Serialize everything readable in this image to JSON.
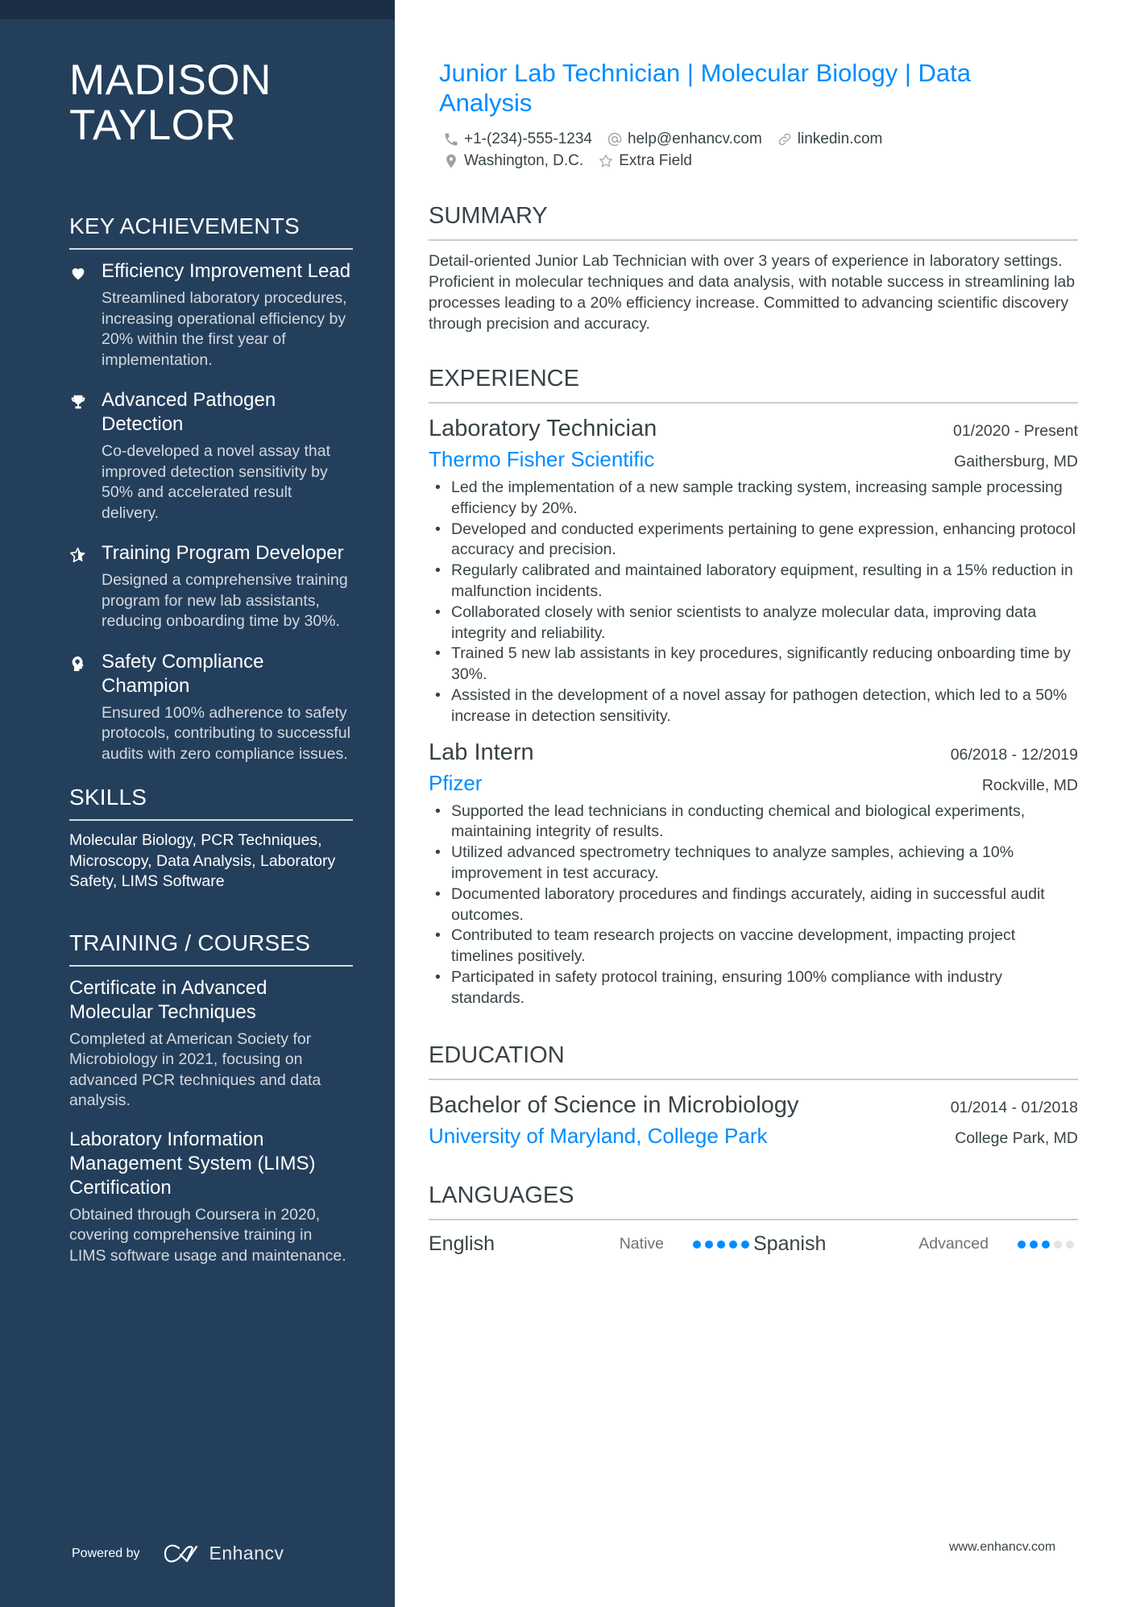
{
  "colors": {
    "sidebar": "#243f5c",
    "sidebar_top": "#1c2e45",
    "accent": "#008cff",
    "text": "#384347"
  },
  "sidebar": {
    "name": "MADISON TAYLOR",
    "achievements_title": "KEY ACHIEVEMENTS",
    "achievements": [
      {
        "icon": "heart-icon",
        "title": "Efficiency Improvement Lead",
        "desc": "Streamlined laboratory procedures, increasing operational efficiency by 20% within the first year of implementation."
      },
      {
        "icon": "trophy-icon",
        "title": "Advanced Pathogen Detection",
        "desc": "Co-developed a novel assay that improved detection sensitivity by 50% and accelerated result delivery."
      },
      {
        "icon": "star-icon",
        "title": "Training Program Developer",
        "desc": "Designed a comprehensive training program for new lab assistants, reducing onboarding time by 30%."
      },
      {
        "icon": "head-icon",
        "title": "Safety Compliance Champion",
        "desc": "Ensured 100% adherence to safety protocols, contributing to successful audits with zero compliance issues."
      }
    ],
    "skills_title": "SKILLS",
    "skills_text": "Molecular Biology, PCR Techniques, Microscopy, Data Analysis, Laboratory Safety, LIMS Software",
    "courses_title": "TRAINING / COURSES",
    "courses": [
      {
        "title": "Certificate in Advanced Molecular Techniques",
        "desc": "Completed at American Society for Microbiology in 2021, focusing on advanced PCR techniques and data analysis."
      },
      {
        "title": "Laboratory Information Management System (LIMS) Certification",
        "desc": "Obtained through Coursera in 2020, covering comprehensive training in LIMS software usage and maintenance."
      }
    ],
    "powered_by": "Powered by",
    "brand": "Enhancv"
  },
  "header": {
    "headline": "Junior Lab Technician | Molecular Biology | Data Analysis",
    "phone": "+1-(234)-555-1234",
    "email": "help@enhancv.com",
    "link": "linkedin.com",
    "location": "Washington, D.C.",
    "extra": "Extra Field"
  },
  "summary": {
    "title": "SUMMARY",
    "text": "Detail-oriented Junior Lab Technician with over 3 years of experience in laboratory settings. Proficient in molecular techniques and data analysis, with notable success in streamlining lab processes leading to a 20% efficiency increase. Committed to advancing scientific discovery through precision and accuracy."
  },
  "experience": {
    "title": "EXPERIENCE",
    "jobs": [
      {
        "title": "Laboratory Technician",
        "dates": "01/2020 - Present",
        "company": "Thermo Fisher Scientific",
        "location": "Gaithersburg, MD",
        "bullets": [
          "Led the implementation of a new sample tracking system, increasing sample processing efficiency by 20%.",
          "Developed and conducted experiments pertaining to gene expression, enhancing protocol accuracy and precision.",
          "Regularly calibrated and maintained laboratory equipment, resulting in a 15% reduction in malfunction incidents.",
          "Collaborated closely with senior scientists to analyze molecular data, improving data integrity and reliability.",
          "Trained 5 new lab assistants in key procedures, significantly reducing onboarding time by 30%.",
          "Assisted in the development of a novel assay for pathogen detection, which led to a 50% increase in detection sensitivity."
        ]
      },
      {
        "title": "Lab Intern",
        "dates": "06/2018 - 12/2019",
        "company": "Pfizer",
        "location": "Rockville, MD",
        "bullets": [
          "Supported the lead technicians in conducting chemical and biological experiments, maintaining integrity of results.",
          "Utilized advanced spectrometry techniques to analyze samples, achieving a 10% improvement in test accuracy.",
          "Documented laboratory procedures and findings accurately, aiding in successful audit outcomes.",
          "Contributed to team research projects on vaccine development, impacting project timelines positively.",
          "Participated in safety protocol training, ensuring 100% compliance with industry standards."
        ]
      }
    ]
  },
  "education": {
    "title": "EDUCATION",
    "degree": "Bachelor of Science in Microbiology",
    "dates": "01/2014 - 01/2018",
    "school": "University of Maryland, College Park",
    "location": "College Park, MD"
  },
  "languages": {
    "title": "LANGUAGES",
    "items": [
      {
        "name": "English",
        "level": "Native",
        "rating": 5,
        "max": 5
      },
      {
        "name": "Spanish",
        "level": "Advanced",
        "rating": 3,
        "max": 5
      }
    ]
  },
  "footer": {
    "url": "www.enhancv.com"
  }
}
